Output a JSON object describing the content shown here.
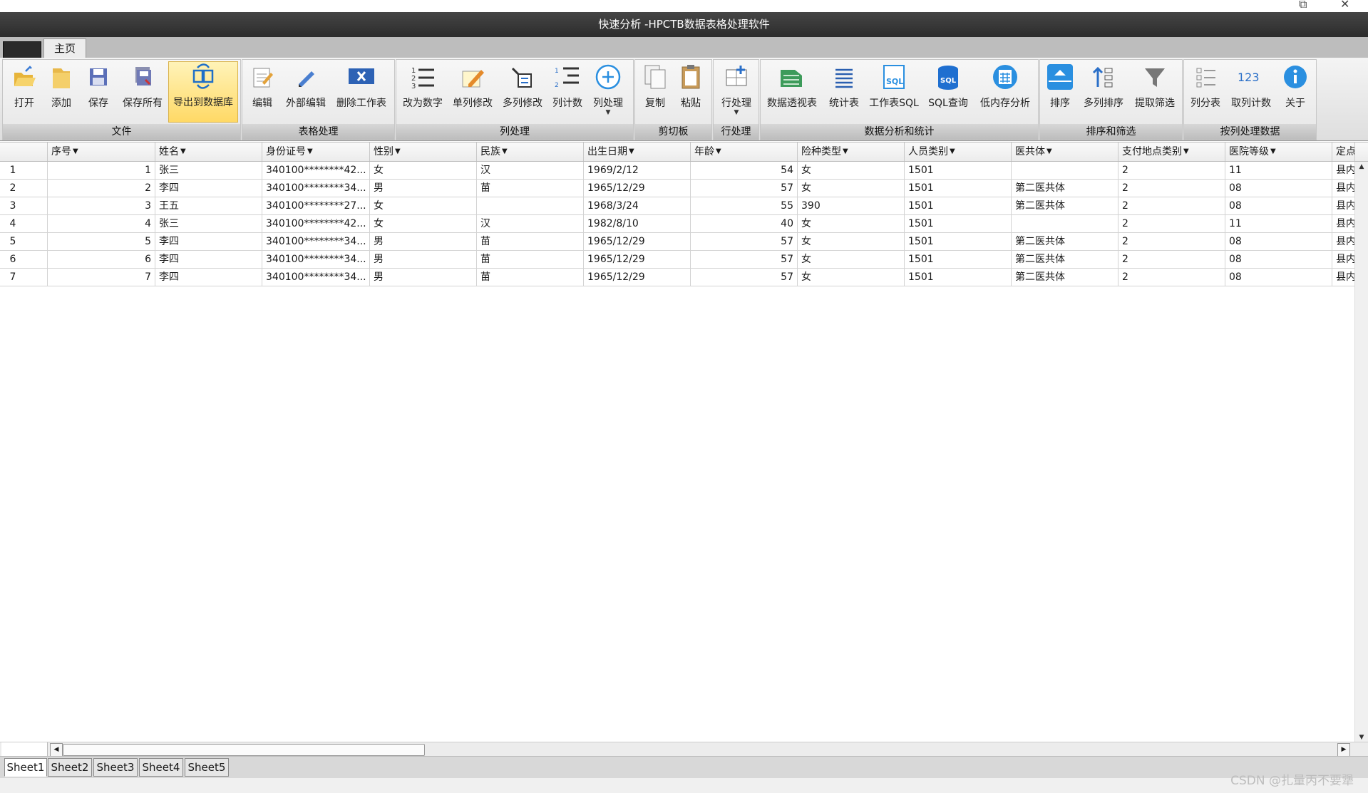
{
  "title": "快速分析 -HPCTB数据表格处理软件",
  "tabs": {
    "home": "主页"
  },
  "ribbon": {
    "groups": {
      "file": "文件",
      "table": "表格处理",
      "column": "列处理",
      "clipboard": "剪切板",
      "row": "行处理",
      "analysis": "数据分析和统计",
      "sort": "排序和筛选",
      "bycol": "按列处理数据"
    },
    "buttons": {
      "open": "打开",
      "add": "添加",
      "save": "保存",
      "save_all": "保存所有",
      "export_db": "导出到数据库",
      "edit": "编辑",
      "external_edit": "外部编辑",
      "delete_sheet": "删除工作表",
      "to_number": "改为数字",
      "single_col_edit": "单列修改",
      "multi_col_edit": "多列修改",
      "col_count": "列计数",
      "col_process": "列处理",
      "copy": "复制",
      "paste": "粘贴",
      "row_process": "行处理",
      "pivot": "数据透视表",
      "stats_table": "统计表",
      "sheet_sql": "工作表SQL",
      "sql_query": "SQL查询",
      "low_mem": "低内存分析",
      "sort": "排序",
      "multi_sort": "多列排序",
      "filter": "提取筛选",
      "split_table": "列分表",
      "take_count": "取列计数",
      "about": "关于"
    }
  },
  "table": {
    "headers": [
      "序号",
      "姓名",
      "身份证号",
      "性别",
      "民族",
      "出生日期",
      "年龄",
      "险种类型",
      "人员类别",
      "医共体",
      "支付地点类别",
      "医院等级",
      "定点"
    ],
    "rows": [
      {
        "rh": "1",
        "c": [
          "1",
          "张三",
          "340100********42...",
          "女",
          "汉",
          "1969/2/12",
          "54",
          "女",
          "1501",
          "",
          "2",
          "11",
          "县内"
        ]
      },
      {
        "rh": "2",
        "c": [
          "2",
          "李四",
          "340100********34...",
          "男",
          "苗",
          "1965/12/29",
          "57",
          "女",
          "1501",
          "第二医共体",
          "2",
          "08",
          "县内"
        ]
      },
      {
        "rh": "3",
        "c": [
          "3",
          "王五",
          "340100********27...",
          "女",
          "",
          "1968/3/24",
          "55",
          "390",
          "1501",
          "第二医共体",
          "2",
          "08",
          "县内"
        ]
      },
      {
        "rh": "4",
        "c": [
          "4",
          "张三",
          "340100********42...",
          "女",
          "汉",
          "1982/8/10",
          "40",
          "女",
          "1501",
          "",
          "2",
          "11",
          "县内"
        ]
      },
      {
        "rh": "5",
        "c": [
          "5",
          "李四",
          "340100********34...",
          "男",
          "苗",
          "1965/12/29",
          "57",
          "女",
          "1501",
          "第二医共体",
          "2",
          "08",
          "县内"
        ]
      },
      {
        "rh": "6",
        "c": [
          "6",
          "李四",
          "340100********34...",
          "男",
          "苗",
          "1965/12/29",
          "57",
          "女",
          "1501",
          "第二医共体",
          "2",
          "08",
          "县内"
        ]
      },
      {
        "rh": "7",
        "c": [
          "7",
          "李四",
          "340100********34...",
          "男",
          "苗",
          "1965/12/29",
          "57",
          "女",
          "1501",
          "第二医共体",
          "2",
          "08",
          "县内"
        ]
      }
    ]
  },
  "sheets": [
    "Sheet1",
    "Sheet2",
    "Sheet3",
    "Sheet4",
    "Sheet5"
  ],
  "watermark": "CSDN @扎量丙不要犟",
  "window_buttons": {
    "restore": "⧉",
    "close": "✕"
  },
  "filter_glyph": "▼"
}
